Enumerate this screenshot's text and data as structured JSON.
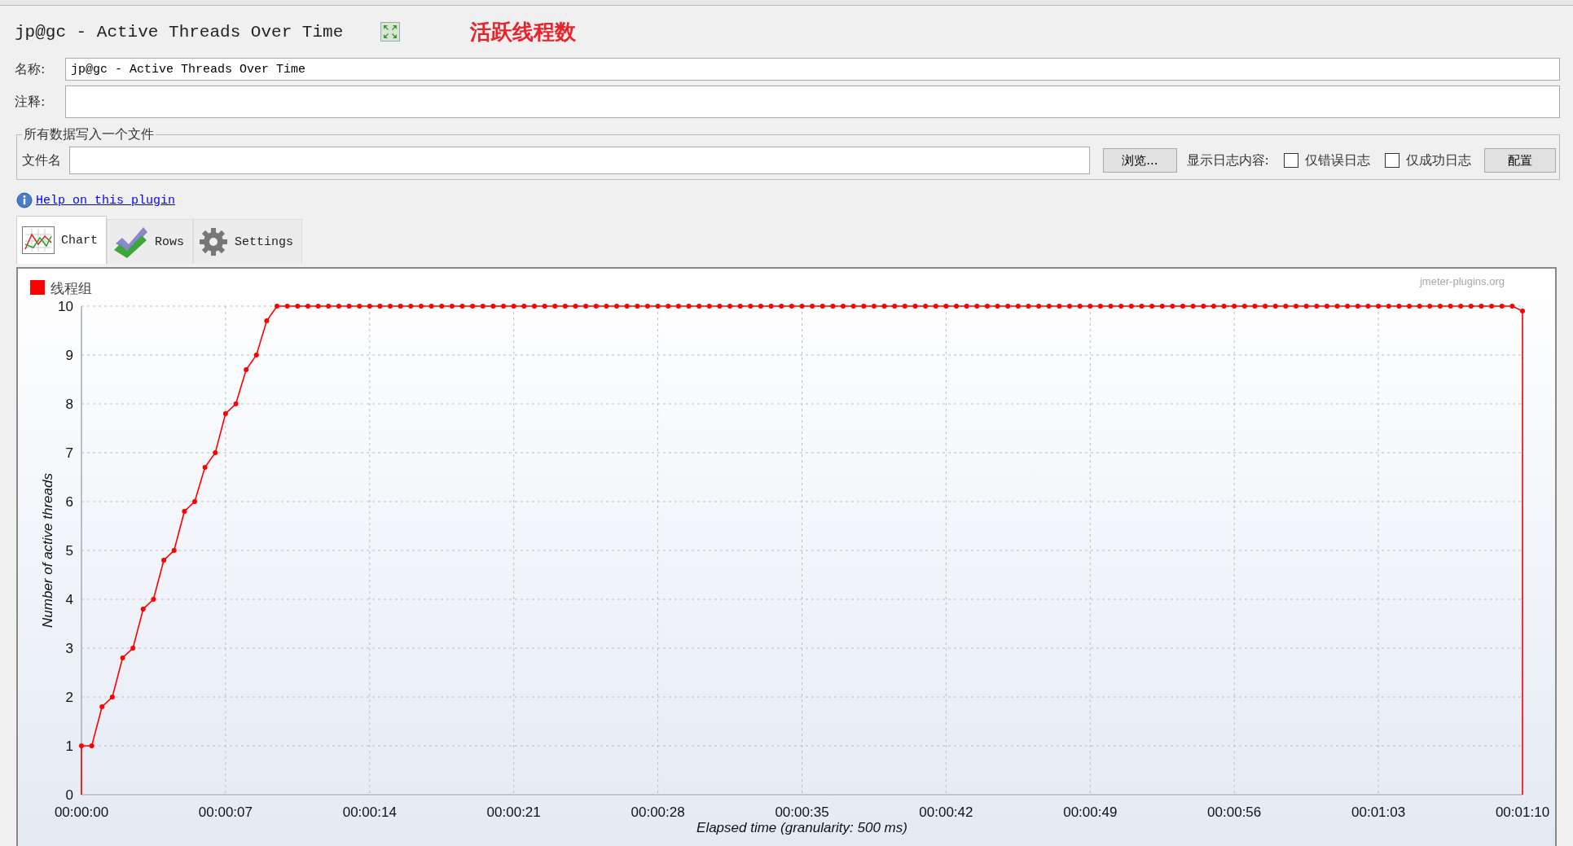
{
  "header": {
    "title": "jp@gc - Active Threads Over Time",
    "annotation": "活跃线程数"
  },
  "name_field": {
    "label": "名称:",
    "value": "jp@gc - Active Threads Over Time"
  },
  "comment_field": {
    "label": "注释:"
  },
  "file_group": {
    "title": "所有数据写入一个文件",
    "file_label": "文件名",
    "browse_button": "浏览...",
    "log_label": "显示日志内容:",
    "checkboxes": [
      {
        "label": "仅错误日志",
        "checked": false
      },
      {
        "label": "仅成功日志",
        "checked": false
      }
    ],
    "config_button": "配置"
  },
  "help_link": "Help on this plugin",
  "tabs": [
    {
      "label": "Chart",
      "kind": "chart",
      "selected": true
    },
    {
      "label": "Rows",
      "kind": "rows",
      "selected": false
    },
    {
      "label": "Settings",
      "kind": "settings",
      "selected": false
    }
  ],
  "chart_panel": {
    "credit": "jmeter-plugins.org",
    "chart_data": {
      "type": "line",
      "grid": true,
      "xlabel": "Elapsed time (granularity: 500 ms)",
      "ylabel": "Number of active threads",
      "xlim": [
        0,
        70
      ],
      "ylim": [
        0,
        10
      ],
      "xticks": [
        {
          "value": 0,
          "label": "00:00:00"
        },
        {
          "value": 7,
          "label": "00:00:07"
        },
        {
          "value": 14,
          "label": "00:00:14"
        },
        {
          "value": 21,
          "label": "00:00:21"
        },
        {
          "value": 28,
          "label": "00:00:28"
        },
        {
          "value": 35,
          "label": "00:00:35"
        },
        {
          "value": 42,
          "label": "00:00:42"
        },
        {
          "value": 49,
          "label": "00:00:49"
        },
        {
          "value": 56,
          "label": "00:00:56"
        },
        {
          "value": 63,
          "label": "00:01:03"
        },
        {
          "value": 70,
          "label": "00:01:10"
        }
      ],
      "yticks": [
        0,
        1,
        2,
        3,
        4,
        5,
        6,
        7,
        8,
        9,
        10
      ],
      "x": [
        0,
        0,
        0.5,
        1,
        1.5,
        2,
        2.5,
        3,
        3.5,
        4,
        4.5,
        5,
        5.5,
        6,
        6.5,
        7,
        7.5,
        8,
        8.5,
        9,
        9.5,
        10,
        10.5,
        11,
        11.5,
        12,
        12.5,
        13,
        13.5,
        14,
        14.5,
        15,
        15.5,
        16,
        16.5,
        17,
        17.5,
        18,
        18.5,
        19,
        19.5,
        20,
        20.5,
        21,
        21.5,
        22,
        22.5,
        23,
        23.5,
        24,
        24.5,
        25,
        25.5,
        26,
        26.5,
        27,
        27.5,
        28,
        28.5,
        29,
        29.5,
        30,
        30.5,
        31,
        31.5,
        32,
        32.5,
        33,
        33.5,
        34,
        34.5,
        35,
        35.5,
        36,
        36.5,
        37,
        37.5,
        38,
        38.5,
        39,
        39.5,
        40,
        40.5,
        41,
        41.5,
        42,
        42.5,
        43,
        43.5,
        44,
        44.5,
        45,
        45.5,
        46,
        46.5,
        47,
        47.5,
        48,
        48.5,
        49,
        49.5,
        50,
        50.5,
        51,
        51.5,
        52,
        52.5,
        53,
        53.5,
        54,
        54.5,
        55,
        55.5,
        56,
        56.5,
        57,
        57.5,
        58,
        58.5,
        59,
        59.5,
        60,
        60.5,
        61,
        61.5,
        62,
        62.5,
        63,
        63.5,
        64,
        64.5,
        65,
        65.5,
        66,
        66.5,
        67,
        67.5,
        68,
        68.5,
        69,
        69.5,
        70,
        70
      ],
      "series": [
        {
          "name": "线程组",
          "color": "#ff0000",
          "marker": "circle",
          "values": [
            0,
            1,
            1,
            1.8,
            2,
            2.8,
            3,
            3.8,
            4,
            4.8,
            5,
            5.8,
            6,
            6.7,
            7,
            7.8,
            8,
            8.7,
            9,
            9.7,
            10,
            10,
            10,
            10,
            10,
            10,
            10,
            10,
            10,
            10,
            10,
            10,
            10,
            10,
            10,
            10,
            10,
            10,
            10,
            10,
            10,
            10,
            10,
            10,
            10,
            10,
            10,
            10,
            10,
            10,
            10,
            10,
            10,
            10,
            10,
            10,
            10,
            10,
            10,
            10,
            10,
            10,
            10,
            10,
            10,
            10,
            10,
            10,
            10,
            10,
            10,
            10,
            10,
            10,
            10,
            10,
            10,
            10,
            10,
            10,
            10,
            10,
            10,
            10,
            10,
            10,
            10,
            10,
            10,
            10,
            10,
            10,
            10,
            10,
            10,
            10,
            10,
            10,
            10,
            10,
            10,
            10,
            10,
            10,
            10,
            10,
            10,
            10,
            10,
            10,
            10,
            10,
            10,
            10,
            10,
            10,
            10,
            10,
            10,
            10,
            10,
            10,
            10,
            10,
            10,
            10,
            10,
            10,
            10,
            10,
            10,
            10,
            10,
            10,
            10,
            10,
            10,
            10,
            10,
            10,
            10,
            9.9,
            0
          ]
        }
      ]
    }
  }
}
